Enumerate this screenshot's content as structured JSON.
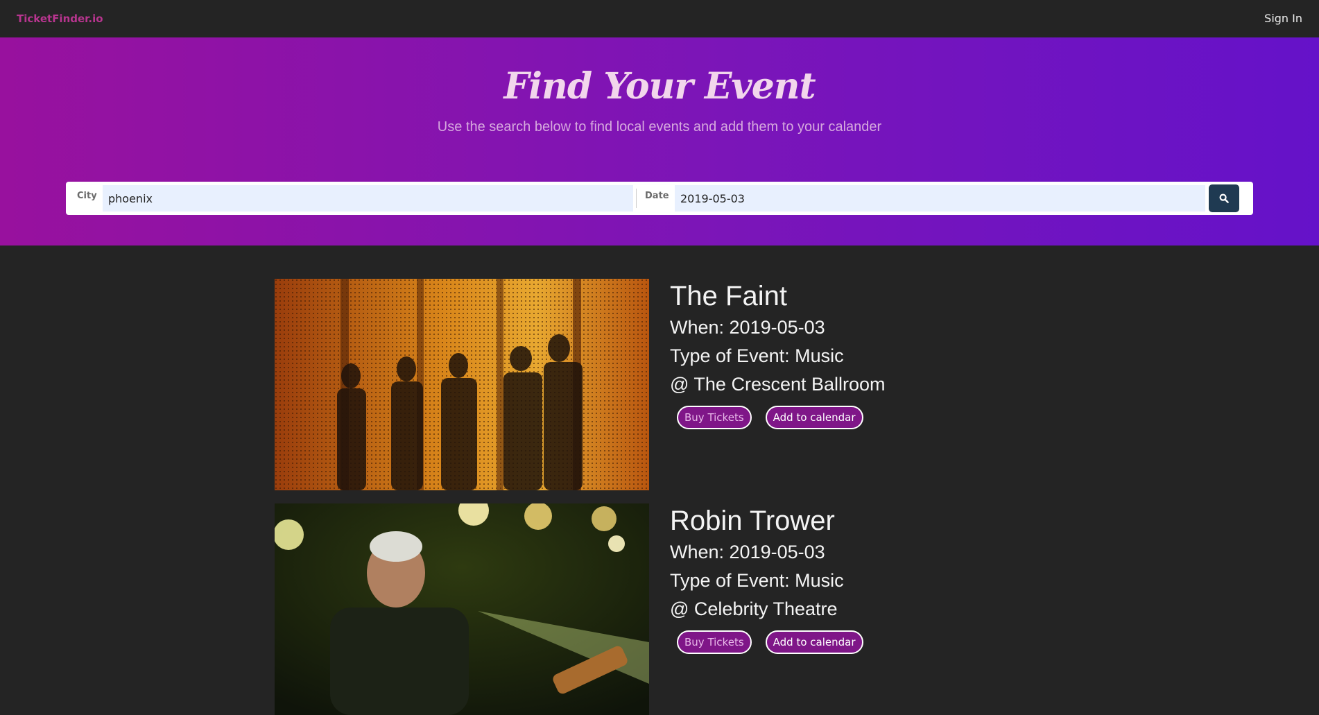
{
  "nav": {
    "brand": "TicketFinder.io",
    "signin": "Sign In"
  },
  "hero": {
    "title": "Find Your Event",
    "subtitle": "Use the search below to find local events and add them to your calander"
  },
  "search": {
    "city_label": "City",
    "city_value": "phoenix",
    "date_label": "Date",
    "date_value": "2019-05-03",
    "button_icon": "search-icon"
  },
  "events": [
    {
      "title": "The Faint",
      "when": "When: 2019-05-03",
      "type": "Type of Event: Music",
      "venue": "@ The Crescent Ballroom",
      "buy_label": "Buy Tickets",
      "calendar_label": "Add to calendar"
    },
    {
      "title": "Robin Trower",
      "when": "When: 2019-05-03",
      "type": "Type of Event: Music",
      "venue": "@ Celebrity Theatre",
      "buy_label": "Buy Tickets",
      "calendar_label": "Add to calendar"
    }
  ]
}
